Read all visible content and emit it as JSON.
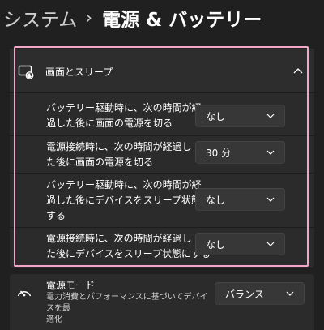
{
  "breadcrumb": {
    "parent": "システム",
    "separator": "›",
    "current": "電源 & バッテリー"
  },
  "section": {
    "title": "画面とスリープ",
    "expanded_icon": "chevron-up-icon",
    "icon": "screen-sleep-icon"
  },
  "settings": [
    {
      "label_line1": "バッテリー駆動時に、次の時間が経",
      "label_line2": "過した後に画面の電源を切る",
      "value": "なし"
    },
    {
      "label_line1": "電源接続時に、次の時間が経過し",
      "label_line2": "た後に画面の電源を切る",
      "value": "30 分"
    },
    {
      "label_line1": "バッテリー駆動時に、次の時間が経",
      "label_line2": "過した後にデバイスをスリープ状態に",
      "label_line3": "する",
      "value": "なし"
    },
    {
      "label_line1": "電源接続時に、次の時間が経過し",
      "label_line2": "た後にデバイスをスリープ状態にする",
      "value": "なし"
    }
  ],
  "power_mode": {
    "title": "電源モード",
    "description_line1": "電力消費とパフォーマンスに基づいてデバイスを最",
    "description_line2": "適化",
    "value": "バランス",
    "icon": "gauge-icon"
  },
  "colors": {
    "background": "#202020",
    "card": "#2b2b2b",
    "highlight": "#f3a7c8",
    "dropdown": "#373737"
  }
}
